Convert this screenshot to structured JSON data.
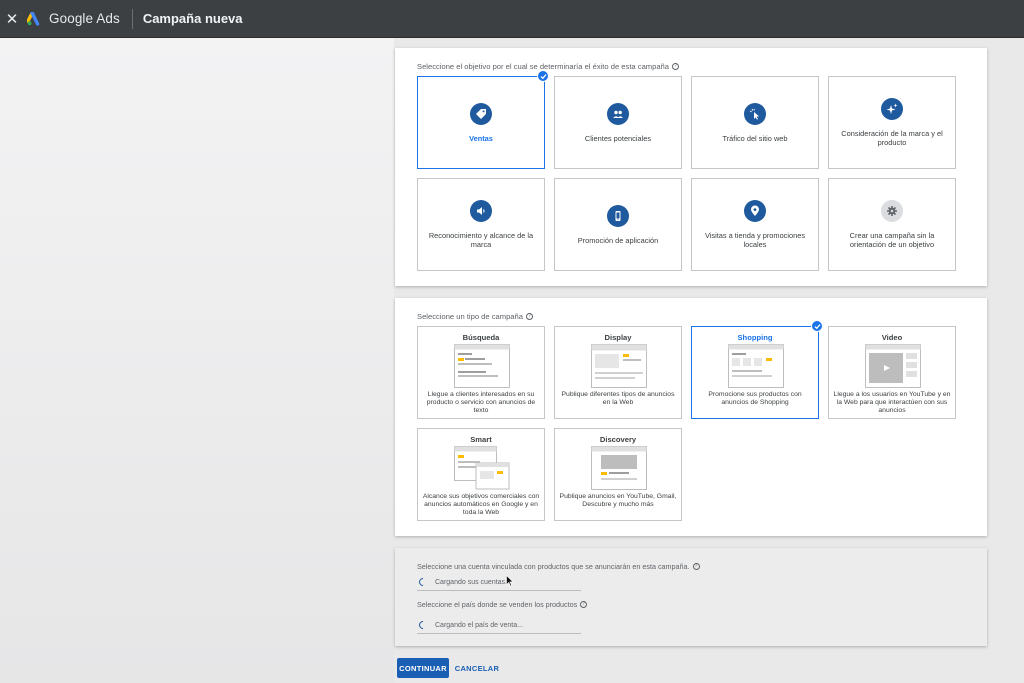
{
  "topbar": {
    "close_icon": "close-icon",
    "brand": "Google Ads",
    "title": "Campaña nueva"
  },
  "objective": {
    "label": "Seleccione el objetivo por el cual se determinaría el éxito de esta campaña",
    "tiles": [
      {
        "label": "Ventas",
        "icon": "tag-icon",
        "selected": true
      },
      {
        "label": "Clientes potenciales",
        "icon": "people-icon",
        "selected": false
      },
      {
        "label": "Tráfico del sitio web",
        "icon": "cursor-click-icon",
        "selected": false
      },
      {
        "label": "Consideración de la marca y el producto",
        "icon": "sparkle-icon",
        "selected": false
      },
      {
        "label": "Reconocimiento y alcance de la marca",
        "icon": "megaphone-icon",
        "selected": false
      },
      {
        "label": "Promoción de aplicación",
        "icon": "phone-icon",
        "selected": false
      },
      {
        "label": "Visitas a tienda y promociones locales",
        "icon": "location-pin-icon",
        "selected": false
      },
      {
        "label": "Crear una campaña sin la orientación de un objetivo",
        "icon": "gear-icon",
        "selected": false
      }
    ]
  },
  "campaign_type": {
    "label": "Seleccione un tipo de campaña",
    "tiles": [
      {
        "name": "Búsqueda",
        "desc": "Llegue a clientes interesados en su producto o servicio con anuncios de texto",
        "selected": false
      },
      {
        "name": "Display",
        "desc": "Publique diferentes tipos de anuncios en la Web",
        "selected": false
      },
      {
        "name": "Shopping",
        "desc": "Promocione sus productos con anuncios de Shopping",
        "selected": true
      },
      {
        "name": "Video",
        "desc": "Llegue a los usuarios en YouTube y en la Web para que interactúen con sus anuncios",
        "selected": false
      },
      {
        "name": "Smart",
        "desc": "Alcance sus objetivos comerciales con anuncios automáticos en Google y en toda la Web",
        "selected": false
      },
      {
        "name": "Discovery",
        "desc": "Publique anuncios en YouTube, Gmail, Descubre y mucho más",
        "selected": false
      }
    ]
  },
  "merchant": {
    "account_label": "Seleccione una cuenta vinculada con productos que se anunciarán en esta campaña.",
    "account_loading": "Cargando sus cuentas...",
    "country_label": "Seleccione el país donde se venden los productos",
    "country_loading": "Cargando el país de venta..."
  },
  "actions": {
    "continue": "CONTINUAR",
    "cancel": "CANCELAR"
  },
  "colors": {
    "accent": "#1a73e8",
    "icon_circle": "#1f5a9e",
    "topbar": "#3c4043"
  }
}
